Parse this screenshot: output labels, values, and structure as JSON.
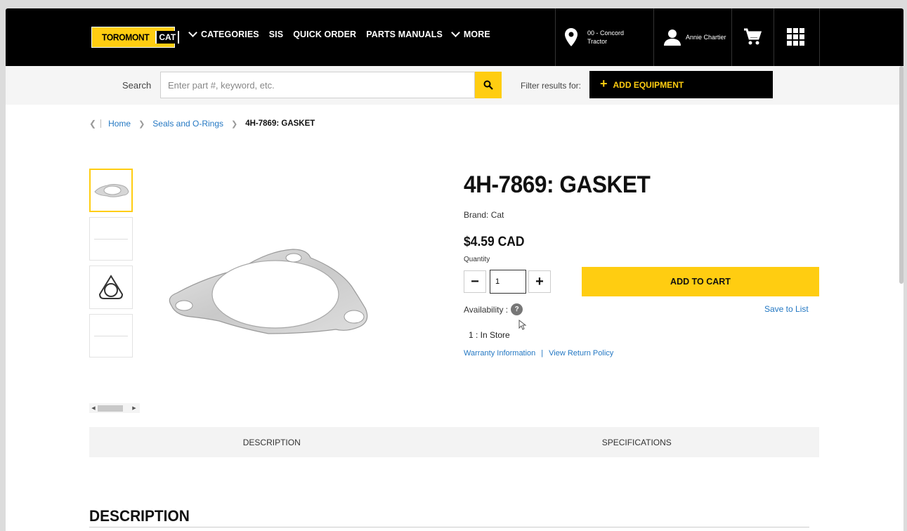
{
  "header": {
    "logo_text": "TOROMONT",
    "logo_cat": "CAT",
    "nav": [
      {
        "label": "CATEGORIES"
      },
      {
        "label": "SIS"
      },
      {
        "label": "QUICK ORDER"
      },
      {
        "label": "PARTS MANUALS"
      },
      {
        "label": "MORE"
      }
    ],
    "store_line1": "00 - Concord",
    "store_line2": "Tractor",
    "user_name": "Annie Chartier"
  },
  "search": {
    "label": "Search",
    "placeholder": "Enter part #, keyword, etc.",
    "filter_label": "Filter results for:",
    "add_equipment": "ADD EQUIPMENT"
  },
  "breadcrumb": {
    "home": "Home",
    "category": "Seals and O-Rings",
    "current": "4H-7869: GASKET"
  },
  "product": {
    "title": "4H-7869: GASKET",
    "brand": "Brand: Cat",
    "price": "$4.59 CAD",
    "quantity_label": "Quantity",
    "quantity_value": "1",
    "add_to_cart": "ADD TO CART",
    "availability_label": "Availability :",
    "save_to_list": "Save to List",
    "stock": "1 : In Store",
    "warranty_link": "Warranty Information",
    "return_link": "View Return Policy"
  },
  "tabs": [
    {
      "label": "DESCRIPTION"
    },
    {
      "label": "SPECIFICATIONS"
    }
  ],
  "section_title": "DESCRIPTION",
  "colors": {
    "accent": "#ffcd11",
    "link": "#2478c3",
    "header_bg": "#000000"
  }
}
